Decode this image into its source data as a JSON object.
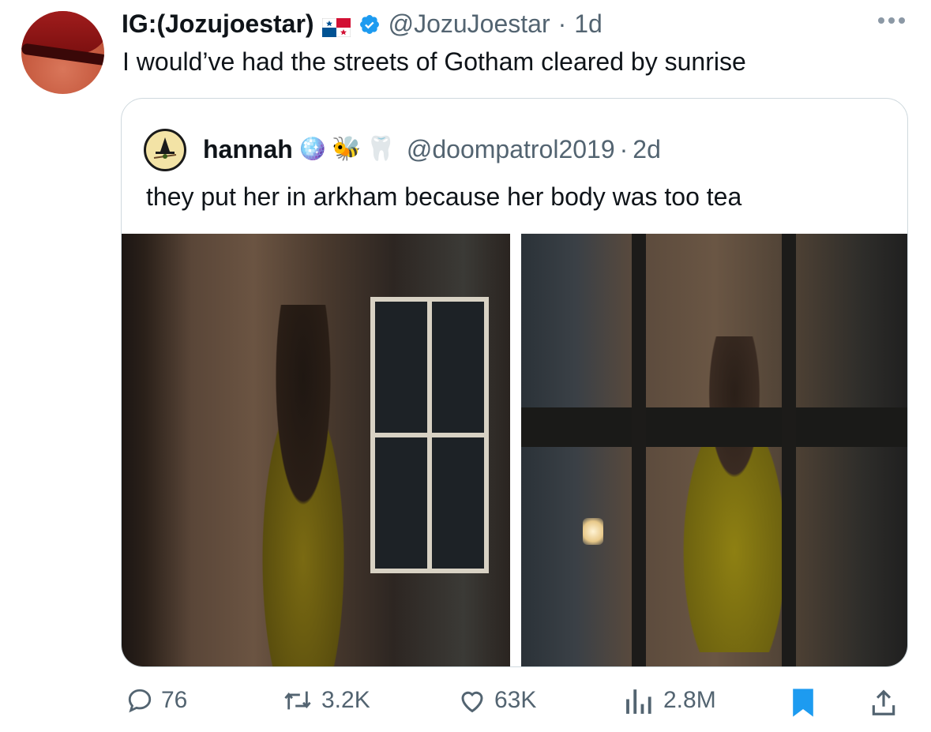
{
  "tweet": {
    "display_name": "IG:(Jozujoestar)",
    "handle": "@JozuJoestar",
    "separator": "·",
    "time": "1d",
    "text": "I would’ve had the streets of Gotham cleared by sunrise"
  },
  "quoted_tweet": {
    "display_name": "hannah",
    "emojis": [
      "🪩",
      "🐝",
      "🦷"
    ],
    "handle": "@doompatrol2019",
    "separator": "·",
    "time": "2d",
    "text": "they put her in arkham because her body was too tea"
  },
  "actions": {
    "replies": "76",
    "reposts": "3.2K",
    "likes": "63K",
    "views": "2.8M"
  },
  "colors": {
    "accent": "#1d9bf0",
    "secondary_text": "#536471",
    "border": "#cfd9de"
  },
  "icons": {
    "reply": "reply-icon",
    "repost": "repost-icon",
    "like": "heart-icon",
    "views": "views-icon",
    "bookmark": "bookmark-icon",
    "share": "share-icon",
    "more": "more-icon",
    "verified": "verified-icon",
    "flag": "panama-flag-icon"
  }
}
